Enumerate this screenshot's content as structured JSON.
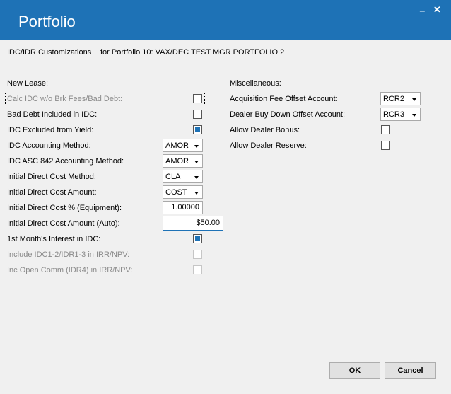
{
  "window": {
    "title": "Portfolio",
    "minimize": "_",
    "close": "✕"
  },
  "header": {
    "section": "IDC/IDR Customizations",
    "portfolio": "for Portfolio 10: VAX/DEC TEST MGR PORTFOLIO 2"
  },
  "new_lease": {
    "heading": "New Lease:",
    "calc_idc": {
      "label": "Calc IDC w/o Brk Fees/Bad Debt:",
      "checked": false
    },
    "bad_debt": {
      "label": "Bad Debt Included in IDC:",
      "checked": false
    },
    "idc_excluded": {
      "label": "IDC Excluded from Yield:",
      "checked": true
    },
    "accounting_method": {
      "label": "IDC Accounting Method:",
      "value": "AMOR"
    },
    "asc842_method": {
      "label": "IDC ASC 842 Accounting Method:",
      "value": "AMOR"
    },
    "initial_method": {
      "label": "Initial Direct Cost Method:",
      "value": "CLA"
    },
    "initial_amount": {
      "label": "Initial Direct Cost Amount:",
      "value": "COST"
    },
    "initial_pct": {
      "label": "Initial Direct Cost % (Equipment):",
      "value": "1.00000"
    },
    "initial_auto": {
      "label": "Initial Direct Cost Amount (Auto):",
      "value": "$50.00"
    },
    "first_month": {
      "label": "1st Month's Interest in IDC:",
      "checked": true
    },
    "include_idc": {
      "label": "Include IDC1-2/IDR1-3 in IRR/NPV:",
      "checked": false
    },
    "inc_open_comm": {
      "label": "Inc Open Comm (IDR4) in IRR/NPV:",
      "checked": false
    }
  },
  "misc": {
    "heading": "Miscellaneous:",
    "acq_fee": {
      "label": "Acquisition Fee Offset Account:",
      "value": "RCR2"
    },
    "dealer_buy": {
      "label": "Dealer Buy Down Offset Account:",
      "value": "RCR3"
    },
    "dealer_bonus": {
      "label": "Allow Dealer Bonus:",
      "checked": false
    },
    "dealer_reserve": {
      "label": "Allow Dealer Reserve:",
      "checked": false
    }
  },
  "buttons": {
    "ok": "OK",
    "cancel": "Cancel"
  },
  "colors": {
    "accent": "#1e72b6",
    "background": "#f0f0f0"
  }
}
